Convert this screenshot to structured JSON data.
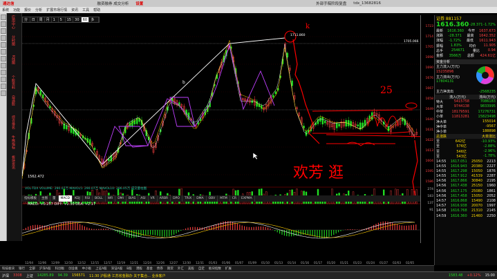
{
  "title": {
    "app": "通达信",
    "center_text": "融资融券 成交分析",
    "right_text": "外部手稿阶段复盘",
    "brand_hot": "设置",
    "right2": "tdx_13682816"
  },
  "menu": [
    "系统",
    "功能",
    "报价",
    "分析",
    "扩展市场行情",
    "资讯",
    "工具",
    "帮助"
  ],
  "periods": [
    "分钟",
    "日线",
    "周",
    "月",
    "1分",
    "5分",
    "15分",
    "30分",
    "60分",
    "多周期"
  ],
  "period_selected": 8,
  "side_nav": [
    "应用中心",
    "分时图",
    "K线图",
    "个股资料",
    "自选股",
    "综合排名",
    "牛熊指标",
    "板块资讯"
  ],
  "chart": {
    "high_label": "1711.860",
    "low_label": "1562.472",
    "top_right_label": "1705.066",
    "axis_ticks": [
      "1723",
      "1714",
      "1705",
      "1698",
      "1690",
      "1676",
      "1667",
      "1658",
      "1649",
      "1640",
      "1631",
      "1622",
      "1613",
      "1604",
      "1595",
      "1586"
    ],
    "vol_label": "VOL-TDX  VOLUME: 290.07万  MAVOL5: 290.07万  MAVOL10: 286.05万  成交量柱图",
    "vol_ticks": [
      "274",
      "183",
      "137",
      "91"
    ],
    "macd_label": "MACD: +0.257  DIFF: +2.30  DEA: +2.17",
    "annotation_letter": "b",
    "handwritten_25": "25",
    "handwritten_k": "k",
    "handwritten_chars": "欢芳 逛"
  },
  "dates": [
    "12/04",
    "12/06",
    "12/09",
    "12/10",
    "12/12",
    "12/15",
    "12/17",
    "12/19",
    "12/21",
    "12/24",
    "12/26",
    "12/27",
    "12/30",
    "12/31",
    "01/03",
    "01/06",
    "01/07",
    "01/09",
    "01/10",
    "01/13",
    "01/14",
    "01/16",
    "01/17",
    "01/20",
    "01/21",
    "01/23",
    "01/24",
    "01/27",
    "02/03",
    "02/05"
  ],
  "subtabs": [
    "指标模板",
    "主图",
    "量",
    "MACD",
    "KDJ",
    "RSI",
    "BOLL",
    "WR",
    "DMI",
    "BIAS",
    "ASI",
    "VR",
    "ARBR",
    "DPO",
    "TRIX",
    "DMA",
    "OBV",
    "MTM",
    "CR",
    "EXPMA"
  ],
  "panel": {
    "header": "证券 881157",
    "price": "1616.360",
    "change": "-28.371",
    "pct": "-1.72%",
    "quote_rows": [
      [
        "最新",
        "1616.360",
        "今开",
        "1637.673"
      ],
      [
        "涨跌",
        "-28.371",
        "最高",
        "1642.352"
      ],
      [
        "涨幅",
        "-1.72%",
        "最低",
        "1611.943"
      ],
      [
        "振幅",
        "1.83%",
        "均价",
        "11.905"
      ],
      [
        "总手",
        "254671",
        "量比",
        "0.94"
      ],
      [
        "金额",
        "3566万",
        "总额",
        "424.61亿"
      ]
    ],
    "funds_title": "资金分析",
    "main_in": "主力流入(万元)",
    "main_in_val": "15235896",
    "main_out": "主力流出(万元)",
    "main_out_val": "17804131",
    "net_label": "主力净流出",
    "net_val": "-2568235",
    "flow_header": [
      "",
      "流入(万元)",
      "流出(万元)"
    ],
    "flow_rows": [
      [
        "特大",
        "5415758",
        "7086183"
      ],
      [
        "大单",
        "9744138",
        "9833995"
      ],
      [
        "中单",
        "18179591",
        "17276731"
      ],
      [
        "小单",
        "11813281",
        "15823498"
      ]
    ],
    "extra_rows": [
      [
        "净大单",
        "155014"
      ],
      [
        "净中单",
        "-9567"
      ],
      [
        "净小单",
        "188898"
      ]
    ],
    "board_header": [
      "总涨跌",
      "大单涨比"
    ],
    "board_rows": [
      [
        "至",
        "642亿",
        "-10.93%"
      ],
      [
        "至",
        "576亿",
        "-2.88%"
      ],
      [
        "至",
        "546亿",
        "-2.96%"
      ],
      [
        "至",
        "543亿",
        "-1.78%"
      ]
    ],
    "ticks": [
      [
        "14:55",
        "1617.051",
        "25050",
        "2213"
      ],
      [
        "14:55",
        "1616.943",
        "20380",
        "2227"
      ],
      [
        "14:55",
        "1617.298",
        "15050",
        "1876"
      ],
      [
        "14:55",
        "1617.912",
        "41539",
        "2287"
      ],
      [
        "14:56",
        "1617.866",
        "30840",
        "2195"
      ],
      [
        "14:56",
        "1617.438",
        "25150",
        "1960"
      ],
      [
        "14:56",
        "1617.175",
        "25080",
        "1861"
      ],
      [
        "14:56",
        "1617.458",
        "15050",
        "2052"
      ],
      [
        "14:57",
        "1616.868",
        "15490",
        "2108"
      ],
      [
        "14:57",
        "1616.938",
        "20070",
        "1997"
      ],
      [
        "14:58",
        "1616.768",
        "21310",
        "2145"
      ],
      [
        "14:59",
        "1616.360",
        "21460",
        "2250"
      ]
    ]
  },
  "bottom_tabs": [
    "科技板块",
    "银行",
    "全部",
    "沪深A股",
    "科创板",
    "创业板",
    "中小板",
    "上证A股",
    "深证A股",
    "B股",
    "港股",
    "基金",
    "债券",
    "期货",
    "外汇",
    "美股",
    "自定",
    "板块指数",
    "扩展"
  ],
  "status": {
    "index1_name": "沪深",
    "index1_val": "3308",
    "index2": "上证",
    "val2": "14285.89",
    "val3": "94.39",
    "val4": "156571",
    "news": "11:30 沪股通 江苏省金融办 关于集合... 业余客户",
    "right_index": "1583.48",
    "right_pct": "+0.12%",
    "clock": "15:00"
  },
  "taskbar": [
    "腾讯",
    "通达信",
    "QQ",
    "视频对话",
    "锁定(6,50.50)"
  ],
  "colors": {
    "up": "#ff4040",
    "down": "#22dd22",
    "trend": "#ffffff",
    "purple": "#c040ff",
    "handwrite": "#ff0000"
  }
}
